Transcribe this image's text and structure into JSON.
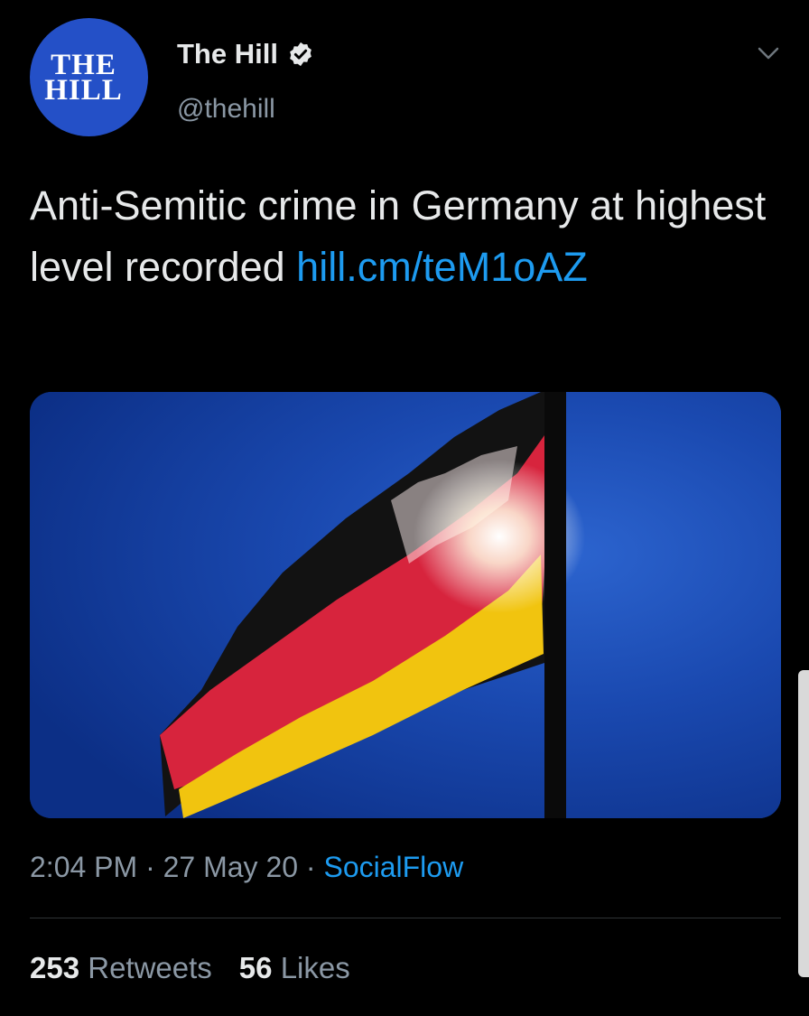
{
  "author": {
    "avatar_text_line1": "THE",
    "avatar_text_line2": "HILL",
    "display_name": "The Hill",
    "handle": "@thehill",
    "verified_icon": "verified-badge-icon"
  },
  "menu_icon": "chevron-down-icon",
  "tweet": {
    "text": "Anti-Semitic crime in Germany at highest level recorded ",
    "link": "hill.cm/teM1oAZ",
    "media_description_icon": "german-flag-photo"
  },
  "meta": {
    "time": "2:04 PM",
    "separator": " · ",
    "date": "27 May 20",
    "source": "SocialFlow"
  },
  "stats": {
    "retweets_count": "253",
    "retweets_label": "Retweets",
    "likes_count": "56",
    "likes_label": "Likes"
  },
  "colors": {
    "background": "#000000",
    "link": "#1d9bf0",
    "secondary_text": "#8b98a5",
    "avatar": "#2450c7"
  }
}
